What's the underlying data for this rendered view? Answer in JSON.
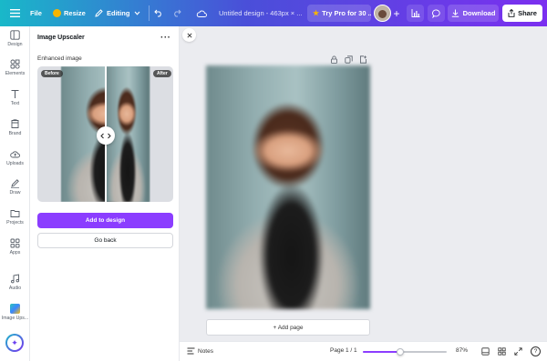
{
  "topbar": {
    "file_label": "File",
    "resize_label": "Resize",
    "editing_label": "Editing",
    "design_title": "Untitled design - 463px × ...",
    "try_pro_label": "Try Pro for 30 ...",
    "download_label": "Download",
    "share_label": "Share"
  },
  "sidebar": {
    "items": [
      {
        "label": "Design",
        "icon": "design-icon"
      },
      {
        "label": "Elements",
        "icon": "elements-icon"
      },
      {
        "label": "Text",
        "icon": "text-icon"
      },
      {
        "label": "Brand",
        "icon": "brand-icon"
      },
      {
        "label": "Uploads",
        "icon": "uploads-icon"
      },
      {
        "label": "Draw",
        "icon": "draw-icon"
      },
      {
        "label": "Projects",
        "icon": "projects-icon"
      },
      {
        "label": "Apps",
        "icon": "apps-icon"
      },
      {
        "label": "Audio",
        "icon": "audio-icon"
      },
      {
        "label": "Image Ups...",
        "icon": "image-upscaler-icon"
      }
    ]
  },
  "panel": {
    "title": "Image Upscaler",
    "section_label": "Enhanced image",
    "before_label": "Before",
    "after_label": "After",
    "add_button": "Add to design",
    "back_button": "Go back"
  },
  "canvas": {
    "add_page_label": "+ Add page"
  },
  "bottombar": {
    "notes_label": "Notes",
    "page_label": "Page 1 / 1",
    "zoom_label": "87%",
    "zoom_fraction": 0.45
  },
  "colors": {
    "accent": "#8b3dff",
    "gradient_start": "#19b8c9",
    "gradient_end": "#7b2ff0"
  }
}
